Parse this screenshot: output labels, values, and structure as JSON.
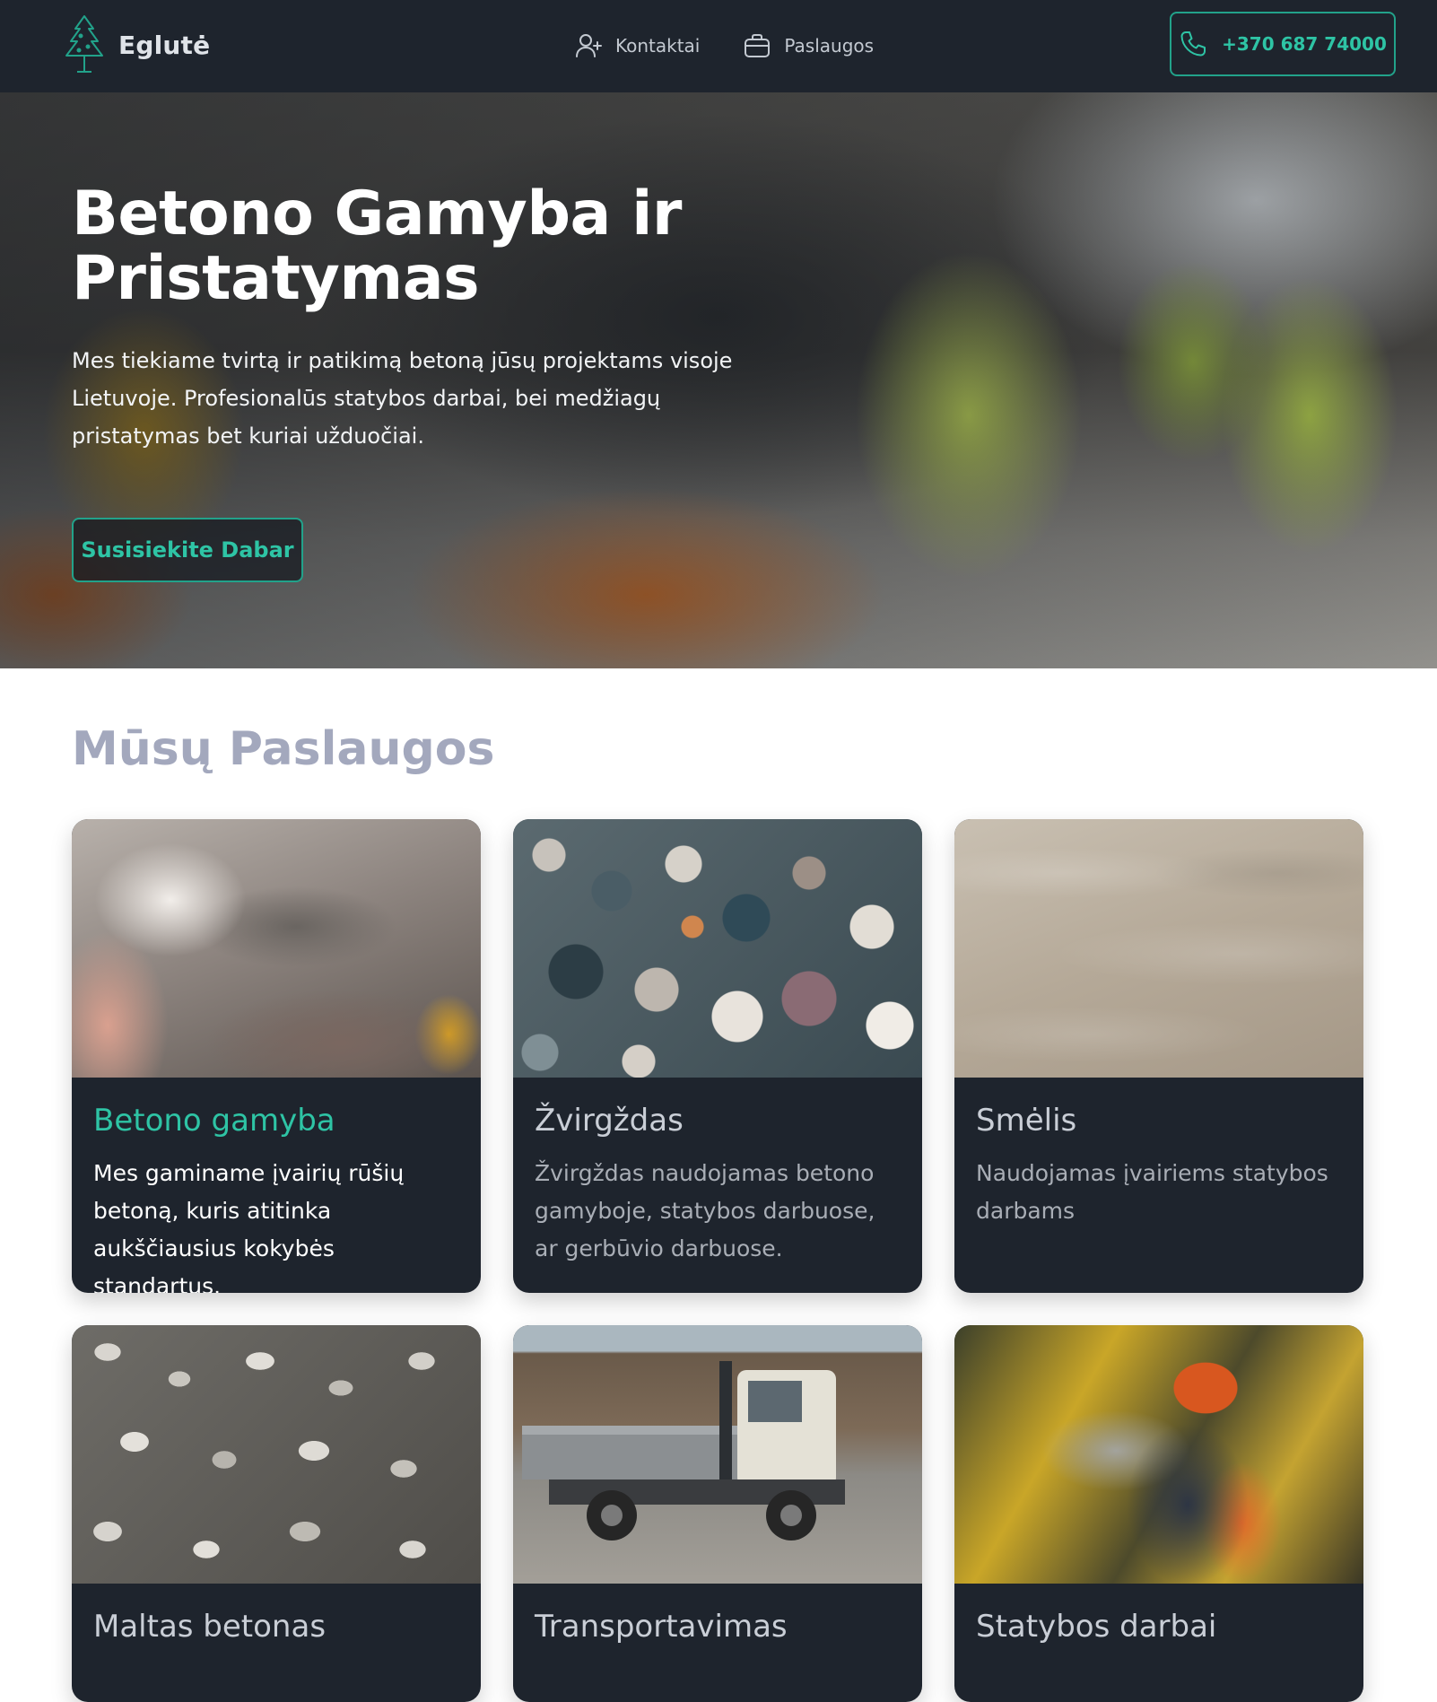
{
  "header": {
    "brand": "Eglutė",
    "nav": [
      {
        "label": "Kontaktai",
        "icon": "user-plus-icon"
      },
      {
        "label": "Paslaugos",
        "icon": "briefcase-icon"
      }
    ],
    "phone": {
      "label": "+370 687 74000",
      "icon": "phone-icon"
    }
  },
  "hero": {
    "title": "Betono Gamyba ir Pristatymas",
    "text": "Mes tiekiame tvirtą ir patikimą betoną jūsų projektams visoje Lietuvoje. Profesionalūs statybos darbai, bei medžiagų pristatymas bet kuriai užduočiai.",
    "cta": "Susisiekite Dabar"
  },
  "services": {
    "title": "Mūsų Paslaugos",
    "cards": [
      {
        "title": "Betono gamyba",
        "description": "Mes gaminame įvairių rūšių betoną, kuris atitinka aukščiausius kokybės standartus."
      },
      {
        "title": "Žvirgždas",
        "description": "Žvirgždas naudojamas betono gamyboje, statybos darbuose, ar gerbūvio darbuose."
      },
      {
        "title": "Smėlis",
        "description": "Naudojamas įvairiems statybos darbams"
      },
      {
        "title": "Maltas betonas",
        "description": ""
      },
      {
        "title": "Transportavimas",
        "description": ""
      },
      {
        "title": "Statybos darbai",
        "description": ""
      }
    ]
  },
  "colors": {
    "header_bg": "#1e242d",
    "accent": "#2ec4a5",
    "section_title": "#a3a8bd",
    "card_bg": "#1e242d"
  }
}
